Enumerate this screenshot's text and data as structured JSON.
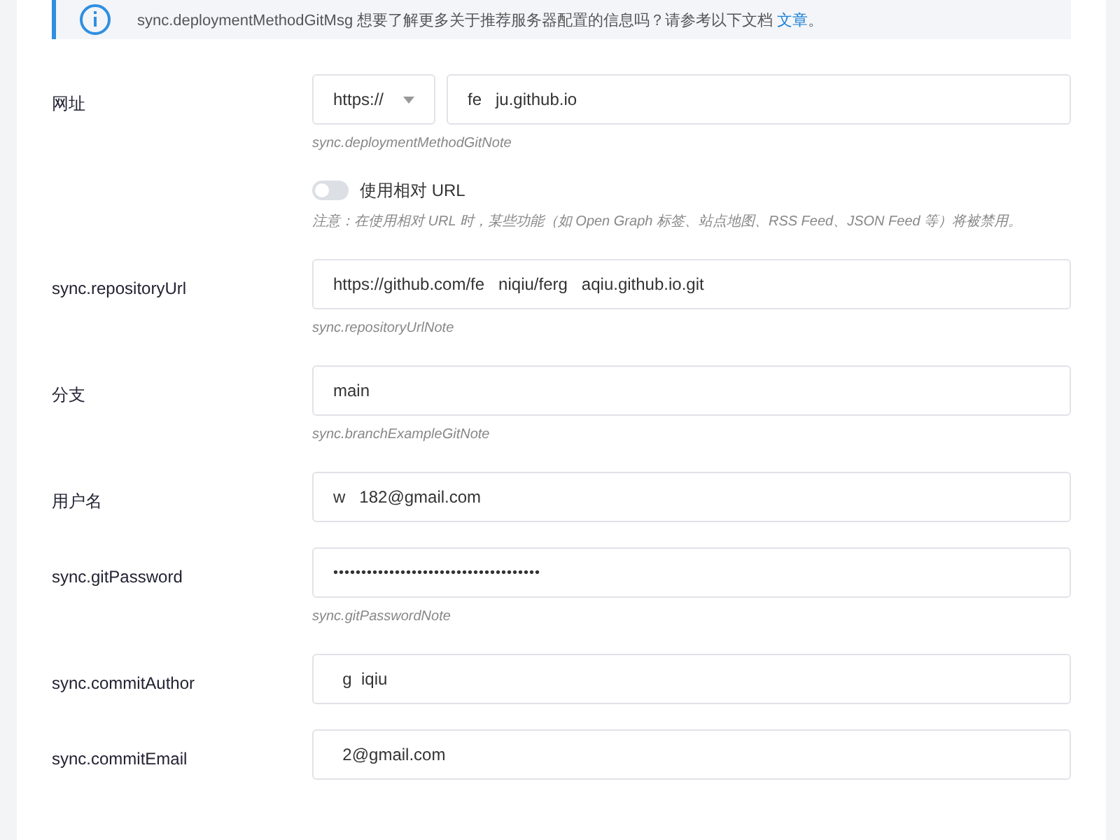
{
  "info": {
    "message": "sync.deploymentMethodGitMsg 想要了解更多关于推荐服务器配置的信息吗？请参考以下文档 ",
    "link": "文章",
    "end": "。"
  },
  "rows": [
    {
      "kind": "url",
      "label": "网址",
      "protocol": "https://",
      "value": "fe   ju.github.io",
      "note": "sync.deploymentMethodGitNote"
    },
    {
      "kind": "toggle",
      "toggle_label": "使用相对 URL",
      "on": false,
      "note": "注意：在使用相对 URL 时，某些功能（如 Open Graph 标签、站点地图、RSS Feed、JSON Feed 等）将被禁用。"
    },
    {
      "kind": "text",
      "label": "sync.repositoryUrl",
      "value": "https://github.com/fe   niqiu/ferg   aqiu.github.io.git",
      "note": "sync.repositoryUrlNote"
    },
    {
      "kind": "text",
      "label": "分支",
      "value": "main",
      "note": "sync.branchExampleGitNote"
    },
    {
      "kind": "text",
      "label": "用户名",
      "value": "w   182@gmail.com"
    },
    {
      "kind": "password",
      "label": "sync.gitPassword",
      "value": "•••••••••••••••••••••••••••••••••••••",
      "note": "sync.gitPasswordNote"
    },
    {
      "kind": "text",
      "label": "sync.commitAuthor",
      "value": "  g  iqiu"
    },
    {
      "kind": "text",
      "label": "sync.commitEmail",
      "value": "  2@gmail.com"
    }
  ]
}
